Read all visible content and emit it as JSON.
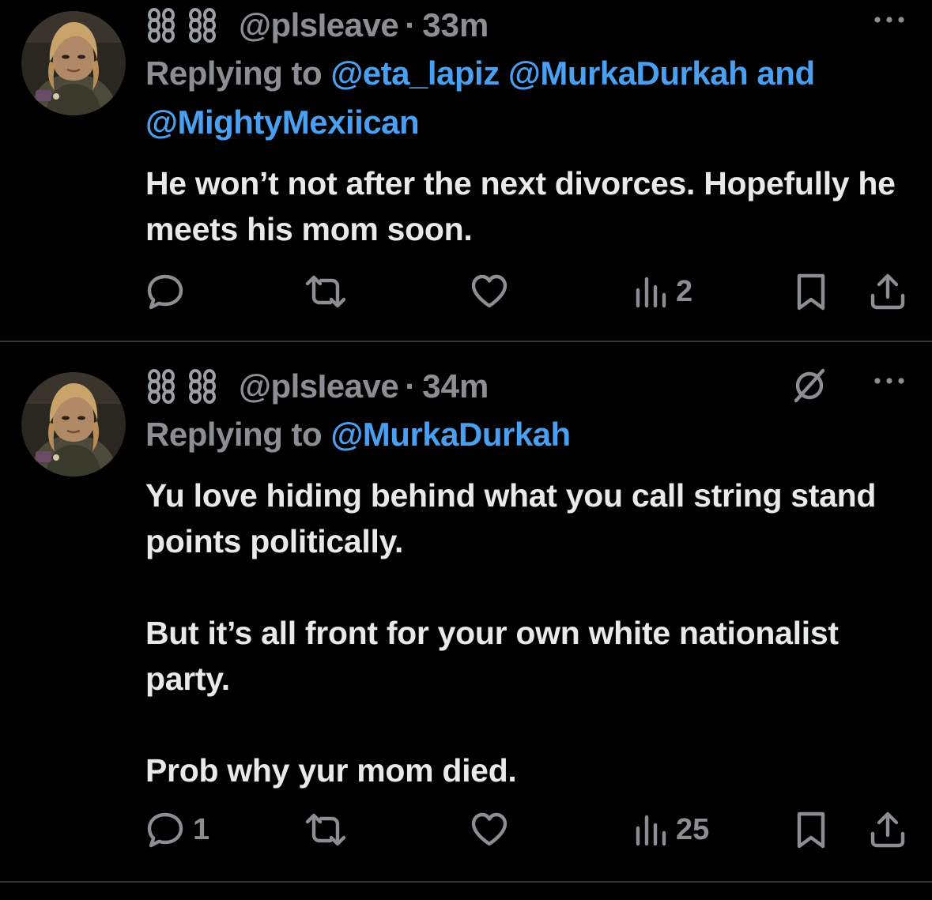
{
  "tweets": [
    {
      "handle": "@plsIeave",
      "separator": "·",
      "time": "33m",
      "replying_prefix": "Replying to ",
      "mentions": [
        "@eta_lapiz",
        "@MurkaDurkah"
      ],
      "mention_joiner": " and",
      "mention_last": "@MightyMexiican",
      "paragraphs": [
        "He won’t not after the next divorces. Hopefully he meets his mom soon."
      ],
      "stats": {
        "replies": "",
        "reposts": "",
        "likes": "",
        "views": "2"
      },
      "icons": [
        "chain-icon",
        "chain-icon",
        "more-icon",
        "reply-icon",
        "repost-icon",
        "like-icon",
        "views-icon",
        "bookmark-icon",
        "share-icon"
      ]
    },
    {
      "handle": "@plsIeave",
      "separator": "·",
      "time": "34m",
      "replying_prefix": "Replying to ",
      "mentions": [
        "@MurkaDurkah"
      ],
      "paragraphs": [
        "Yu love hiding behind what you call string stand points politically.",
        "But it’s all front for your own white nationalist party.",
        "Prob why yur mom died."
      ],
      "stats": {
        "replies": "1",
        "reposts": "",
        "likes": "",
        "views": "25"
      },
      "icons": [
        "chain-icon",
        "chain-icon",
        "grok-icon",
        "more-icon",
        "reply-icon",
        "repost-icon",
        "like-icon",
        "views-icon",
        "bookmark-icon",
        "share-icon"
      ]
    }
  ],
  "colors": {
    "background": "#000000",
    "text": "#e7e9ea",
    "secondary": "#8b8f94",
    "link": "#4a9ff0",
    "divider": "#2f3336"
  }
}
